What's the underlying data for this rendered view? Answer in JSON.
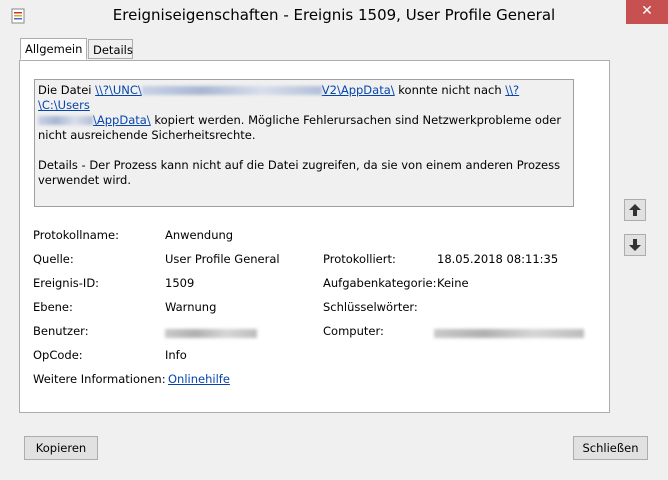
{
  "window": {
    "title": "Ereigniseigenschaften - Ereignis 1509, User Profile General",
    "close_symbol": "✕",
    "icon": "event-viewer-icon"
  },
  "tabs": [
    {
      "label": "Allgemein",
      "active": true
    },
    {
      "label": "Details",
      "active": false
    }
  ],
  "message": {
    "text1": "Die Datei ",
    "link1_start": "\\\\?\\UNC\\",
    "link1_end": "V2\\AppData\\",
    "text2": " konnte nicht nach ",
    "link2_start": "\\\\?\\C:\\Users",
    "link2_end": "\\AppData\\",
    "text3": " kopiert werden. Mögliche Fehlerursachen sind Netzwerkprobleme oder nicht ausreichende Sicherheitsrechte.",
    "details": " Details - Der Prozess kann nicht auf die Datei zugreifen, da sie von einem anderen Prozess verwendet wird."
  },
  "fields": {
    "protokollname_label": "Protokollname:",
    "protokollname_value": "Anwendung",
    "quelle_label": "Quelle:",
    "quelle_value": "User Profile General",
    "protokolliert_label": "Protokolliert:",
    "protokolliert_value": "18.05.2018 08:11:35",
    "ereignis_label": "Ereignis-ID:",
    "ereignis_value": "1509",
    "aufgabe_label": "Aufgabenkategorie:",
    "aufgabe_value": "Keine",
    "ebene_label": "Ebene:",
    "ebene_value": "Warnung",
    "schluessel_label": "Schlüsselwörter:",
    "benutzer_label": "Benutzer:",
    "computer_label": "Computer:",
    "opcode_label": "OpCode:",
    "opcode_value": "Info",
    "weitere_label": "Weitere Informationen:",
    "weitere_link": "Onlinehilfe"
  },
  "nav": {
    "up_icon": "arrow-up-icon",
    "down_icon": "arrow-down-icon"
  },
  "buttons": {
    "copy": "Kopieren",
    "close": "Schließen"
  },
  "colors": {
    "link": "#0645ad",
    "close_button": "#c75050",
    "panel_bg": "#ffffff",
    "window_bg": "#f0f0f0"
  }
}
